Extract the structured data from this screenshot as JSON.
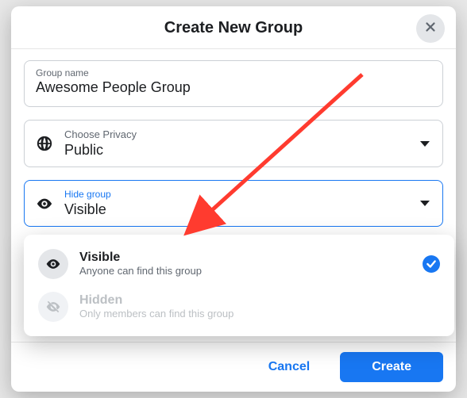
{
  "modal": {
    "title": "Create New Group"
  },
  "groupName": {
    "label": "Group name",
    "value": "Awesome People Group"
  },
  "privacy": {
    "label": "Choose Privacy",
    "value": "Public"
  },
  "visibility": {
    "label": "Hide group",
    "value": "Visible",
    "options": [
      {
        "title": "Visible",
        "subtitle": "Anyone can find this group",
        "selected": true,
        "icon": "eye-icon"
      },
      {
        "title": "Hidden",
        "subtitle": "Only members can find this group",
        "selected": false,
        "icon": "eye-off-icon",
        "disabled": true
      }
    ]
  },
  "footer": {
    "cancel": "Cancel",
    "create": "Create"
  }
}
